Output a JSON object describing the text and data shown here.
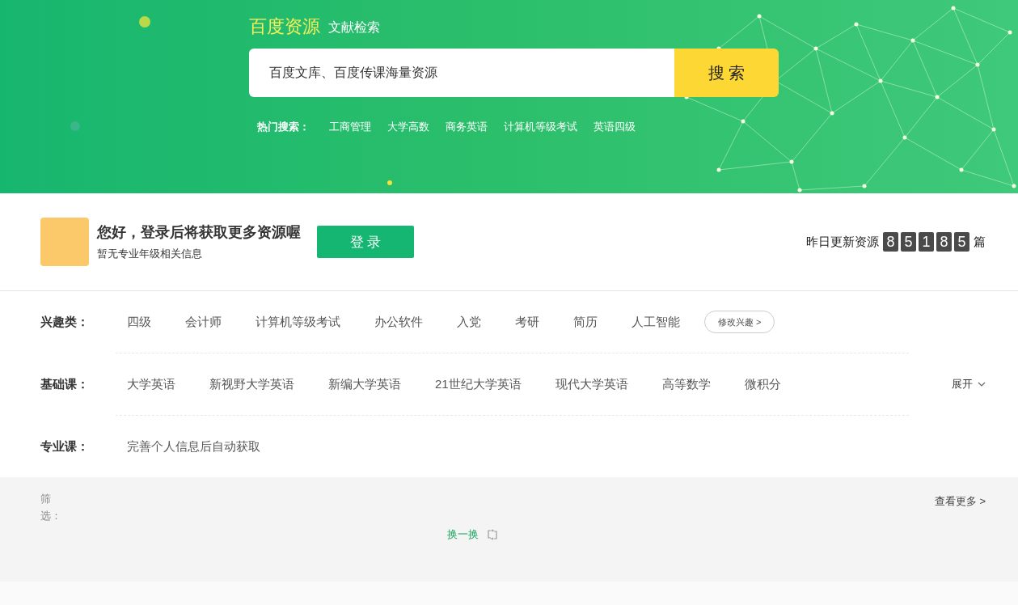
{
  "banner": {
    "brand": "百度资源",
    "subtitle": "文献检索",
    "search": {
      "placeholder": "百度文库、百度传课海量资源"
    },
    "search_button": "搜 索",
    "hot_label": "热门搜索：",
    "hot_searches": [
      "工商管理",
      "大学高数",
      "商务英语",
      "计算机等级考试",
      "英语四级"
    ]
  },
  "user": {
    "greeting": "您好，登录后将获取更多资源喔",
    "info": "暂无专业年级相关信息",
    "login_button": "登 录"
  },
  "updates": {
    "label": "昨日更新资源",
    "digits": [
      "8",
      "5",
      "1",
      "8",
      "5"
    ],
    "unit": "篇"
  },
  "categories": [
    {
      "label": "兴趣类：",
      "items": [
        "四级",
        "会计师",
        "计算机等级考试",
        "办公软件",
        "入党",
        "考研",
        "简历",
        "人工智能"
      ],
      "action": "修改兴趣 >"
    },
    {
      "label": "基础课：",
      "items": [
        "大学英语",
        "新视野大学英语",
        "新编大学英语",
        "21世纪大学英语",
        "现代大学英语",
        "高等数学",
        "微积分"
      ],
      "expand": "展开"
    },
    {
      "label": "专业课：",
      "note": "完善个人信息后自动获取"
    }
  ],
  "filter": {
    "label": "筛选：",
    "more": "查看更多 >",
    "refresh": "换一换"
  }
}
